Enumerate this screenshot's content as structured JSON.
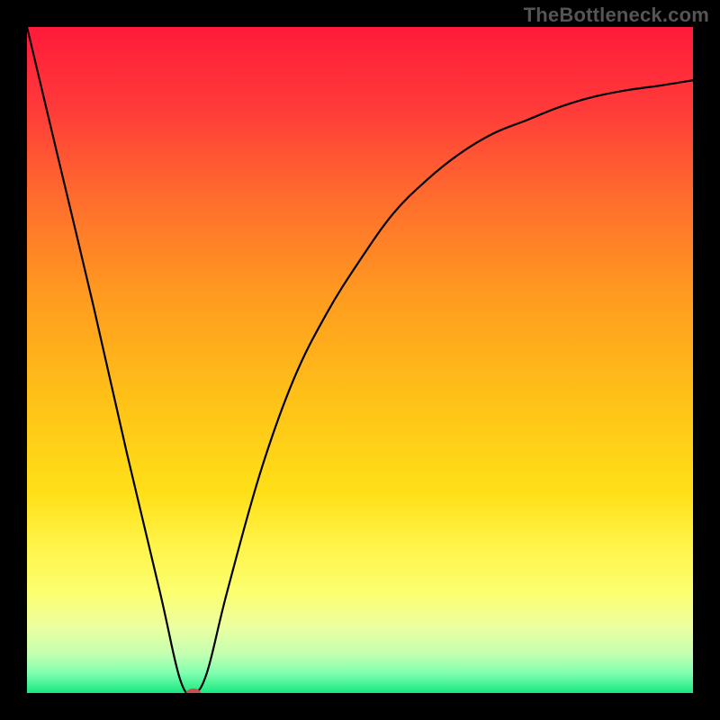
{
  "watermark": "TheBottleneck.com",
  "chart_data": {
    "type": "line",
    "title": "",
    "xlabel": "",
    "ylabel": "",
    "xlim": [
      0,
      100
    ],
    "ylim": [
      0,
      100
    ],
    "grid": false,
    "legend": false,
    "series": [
      {
        "name": "curve",
        "color": "#000000",
        "x": [
          0,
          5,
          10,
          15,
          20,
          23,
          25,
          27,
          30,
          35,
          40,
          45,
          50,
          55,
          60,
          65,
          70,
          75,
          80,
          85,
          90,
          95,
          100
        ],
        "y": [
          100,
          79,
          58,
          36,
          15,
          2,
          0,
          3,
          15,
          33,
          47,
          57,
          65,
          72,
          77,
          81,
          84,
          86,
          88,
          89.5,
          90.5,
          91.2,
          92
        ]
      }
    ],
    "marker": {
      "name": "vertex-marker",
      "x": 25,
      "y": 0,
      "color": "#c94f4f",
      "rx": 8,
      "ry": 5
    },
    "gradient_stops": [
      {
        "offset": 0.0,
        "color": "#ff1a3a"
      },
      {
        "offset": 0.12,
        "color": "#ff3a3a"
      },
      {
        "offset": 0.25,
        "color": "#ff6a2e"
      },
      {
        "offset": 0.4,
        "color": "#ff9a20"
      },
      {
        "offset": 0.55,
        "color": "#ffbf18"
      },
      {
        "offset": 0.7,
        "color": "#ffe018"
      },
      {
        "offset": 0.78,
        "color": "#fff44a"
      },
      {
        "offset": 0.85,
        "color": "#fcff70"
      },
      {
        "offset": 0.9,
        "color": "#ecffa0"
      },
      {
        "offset": 0.94,
        "color": "#c6ffb0"
      },
      {
        "offset": 0.97,
        "color": "#80ffb0"
      },
      {
        "offset": 1.0,
        "color": "#18e880"
      }
    ]
  }
}
